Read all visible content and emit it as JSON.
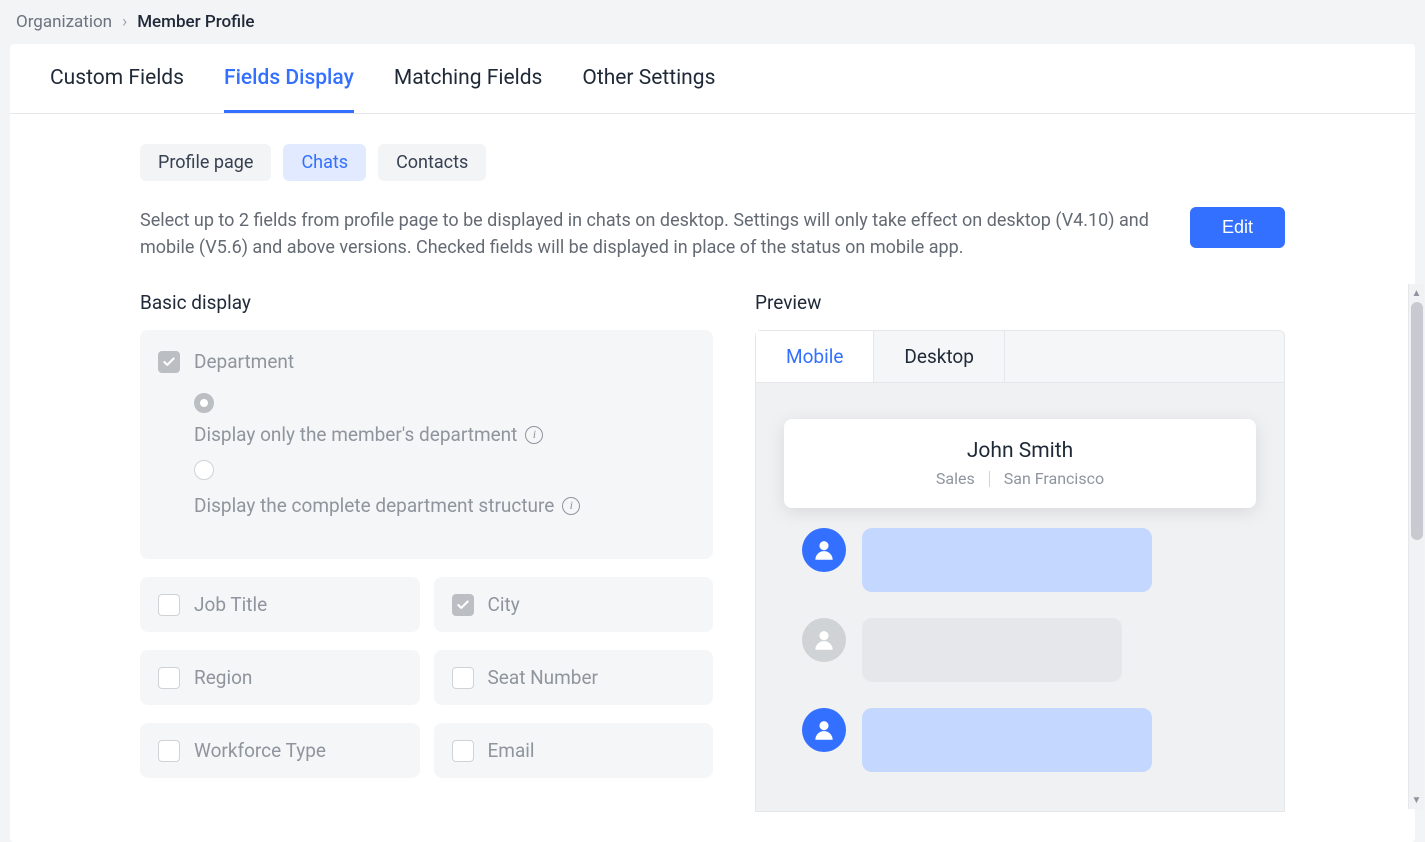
{
  "breadcrumb": {
    "parent": "Organization",
    "current": "Member Profile"
  },
  "mainTabs": [
    {
      "label": "Custom Fields"
    },
    {
      "label": "Fields Display"
    },
    {
      "label": "Matching Fields"
    },
    {
      "label": "Other Settings"
    }
  ],
  "subTabs": [
    {
      "label": "Profile page"
    },
    {
      "label": "Chats"
    },
    {
      "label": "Contacts"
    }
  ],
  "description": "Select up to 2 fields from profile page to be displayed in chats on desktop. Settings will only take effect on desktop (V4.10) and mobile (V5.6) and above versions. Checked fields will be displayed in place of the status on mobile app.",
  "editLabel": "Edit",
  "basicDisplay": {
    "title": "Basic display",
    "department": {
      "label": "Department",
      "radios": [
        {
          "label": "Display only the member's department"
        },
        {
          "label": "Display the complete department structure"
        }
      ]
    },
    "fields": [
      {
        "label": "Job Title",
        "checked": false
      },
      {
        "label": "City",
        "checked": true
      },
      {
        "label": "Region",
        "checked": false
      },
      {
        "label": "Seat Number",
        "checked": false
      },
      {
        "label": "Workforce Type",
        "checked": false
      },
      {
        "label": "Email",
        "checked": false
      }
    ]
  },
  "preview": {
    "title": "Preview",
    "tabs": [
      {
        "label": "Mobile"
      },
      {
        "label": "Desktop"
      }
    ],
    "profile": {
      "name": "John Smith",
      "deptValue": "Sales",
      "cityValue": "San Francisco"
    }
  }
}
